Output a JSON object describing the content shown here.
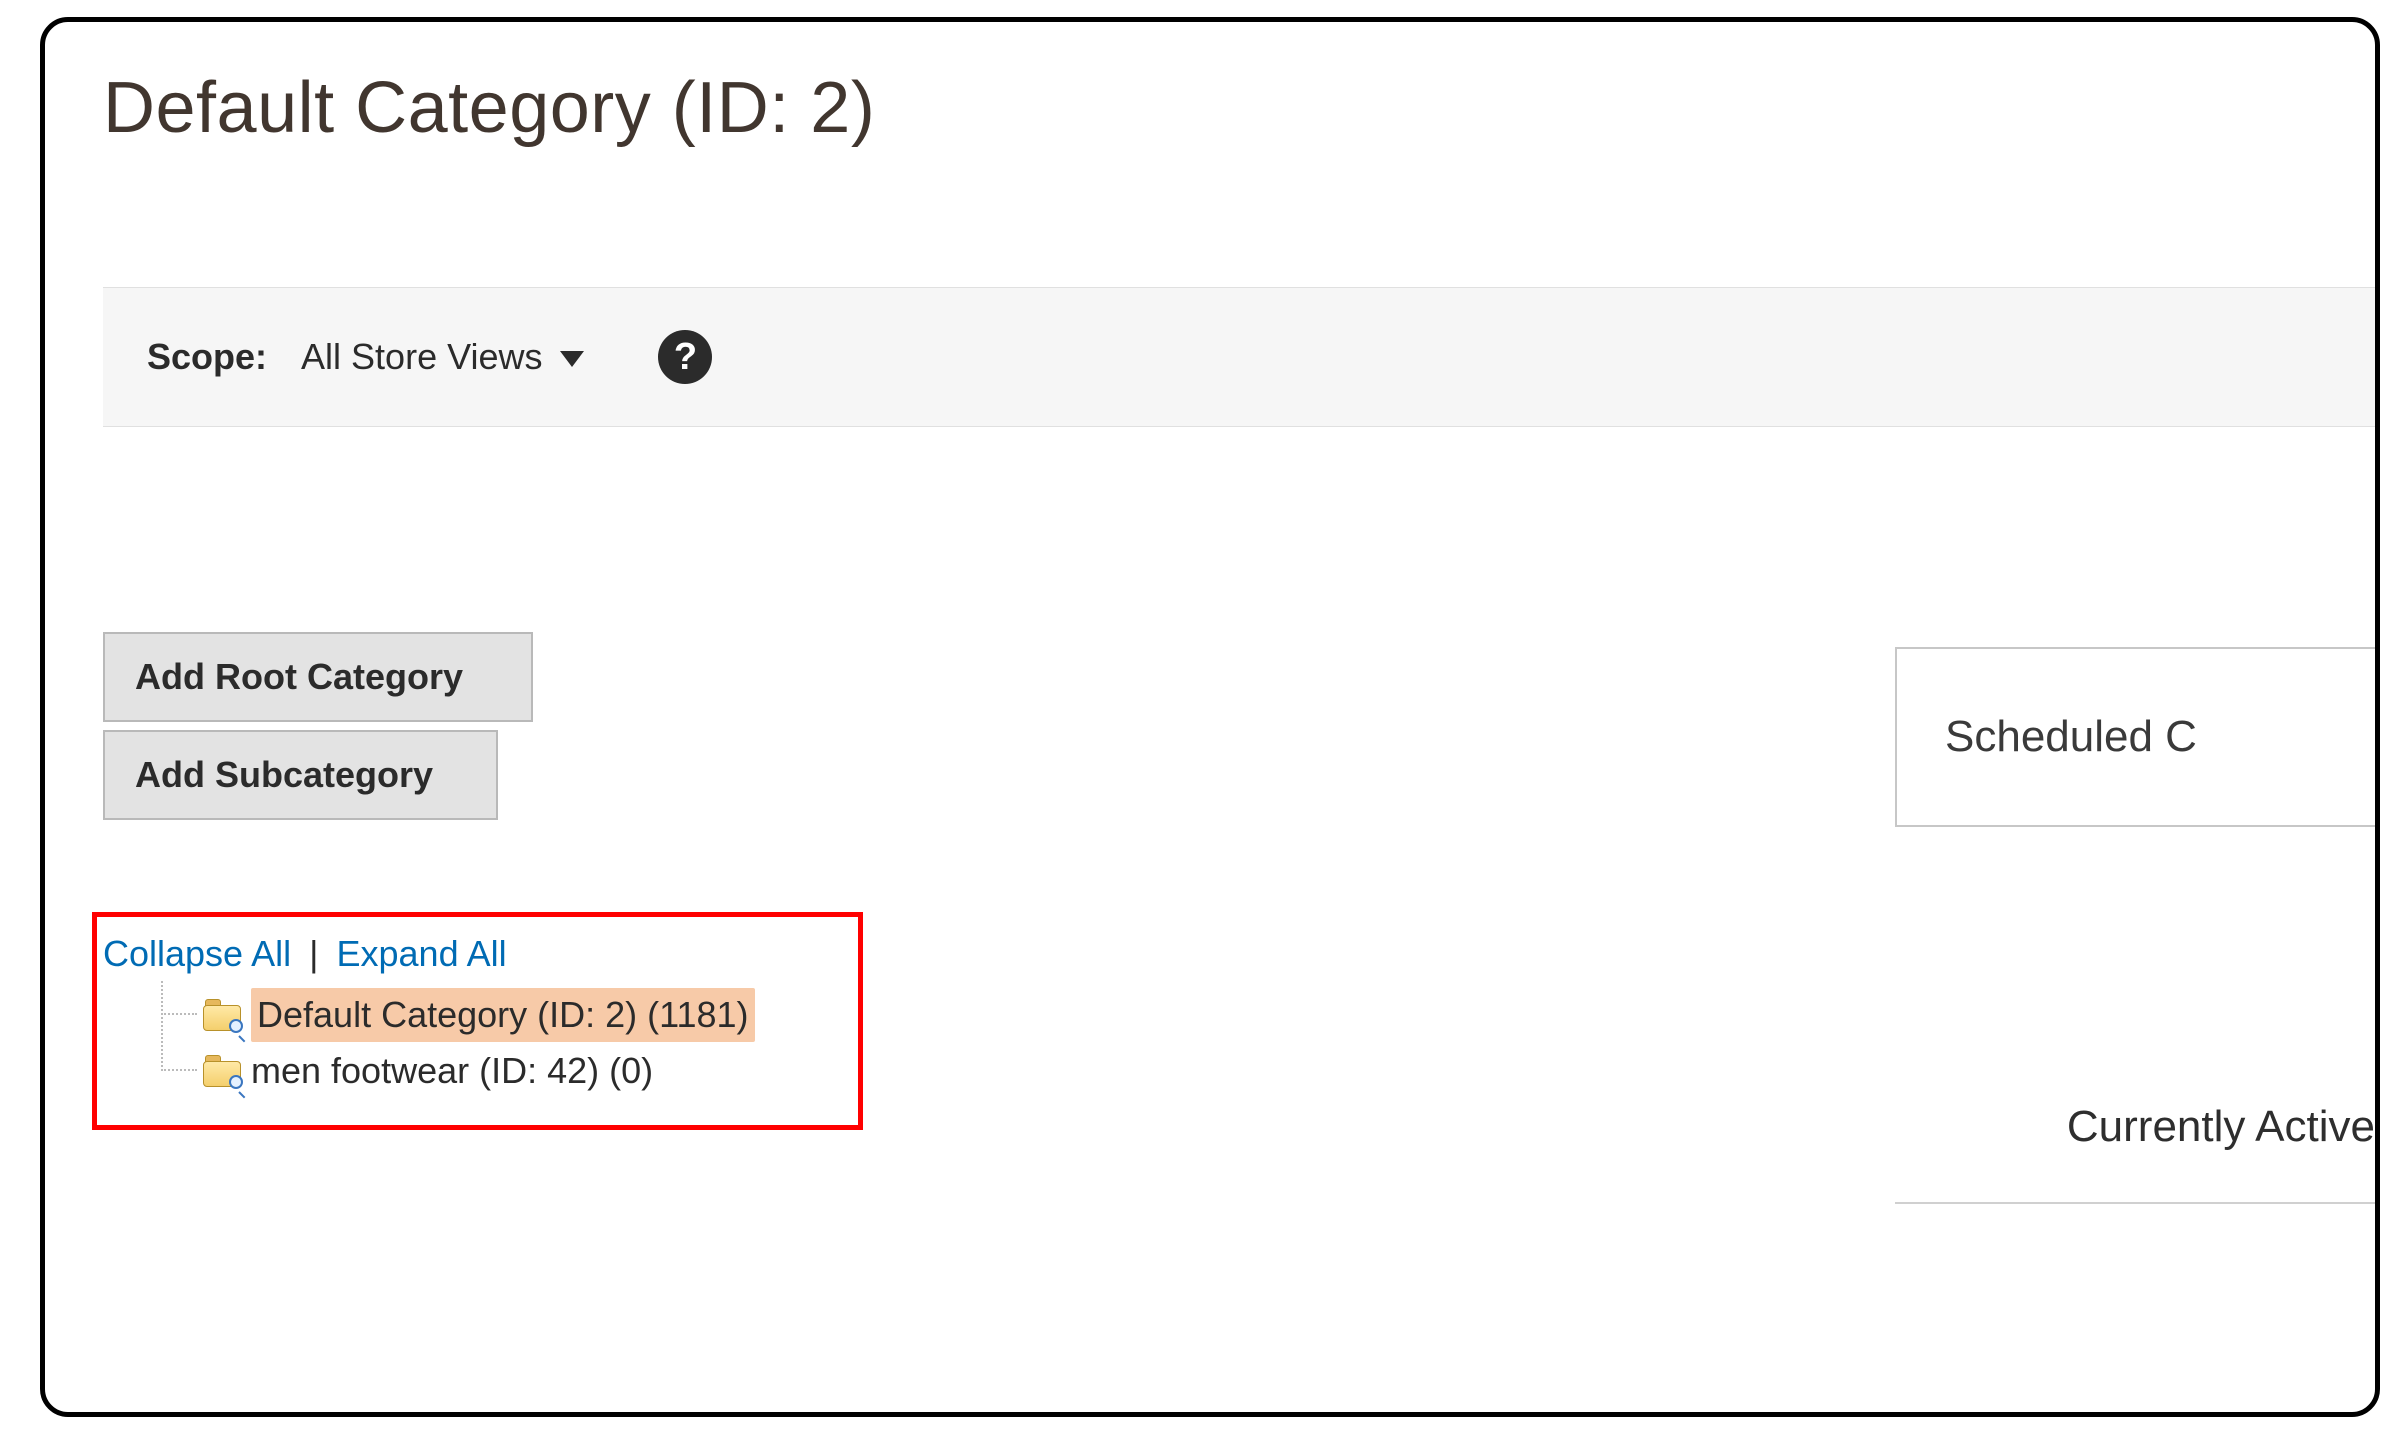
{
  "page_title": "Default Category (ID: 2)",
  "scope": {
    "label": "Scope:",
    "selected": "All Store Views",
    "help_glyph": "?"
  },
  "buttons": {
    "add_root": "Add Root Category",
    "add_sub": "Add Subcategory"
  },
  "tree_controls": {
    "collapse_all": "Collapse All",
    "separator": "|",
    "expand_all": "Expand All"
  },
  "tree": {
    "nodes": [
      {
        "label": "Default Category (ID: 2) (1181)",
        "selected": true
      },
      {
        "label": "men footwear (ID: 42) (0)",
        "selected": false
      }
    ]
  },
  "right": {
    "scheduled_changes_heading": "Scheduled C",
    "currently_active_heading": "Currently Active"
  }
}
